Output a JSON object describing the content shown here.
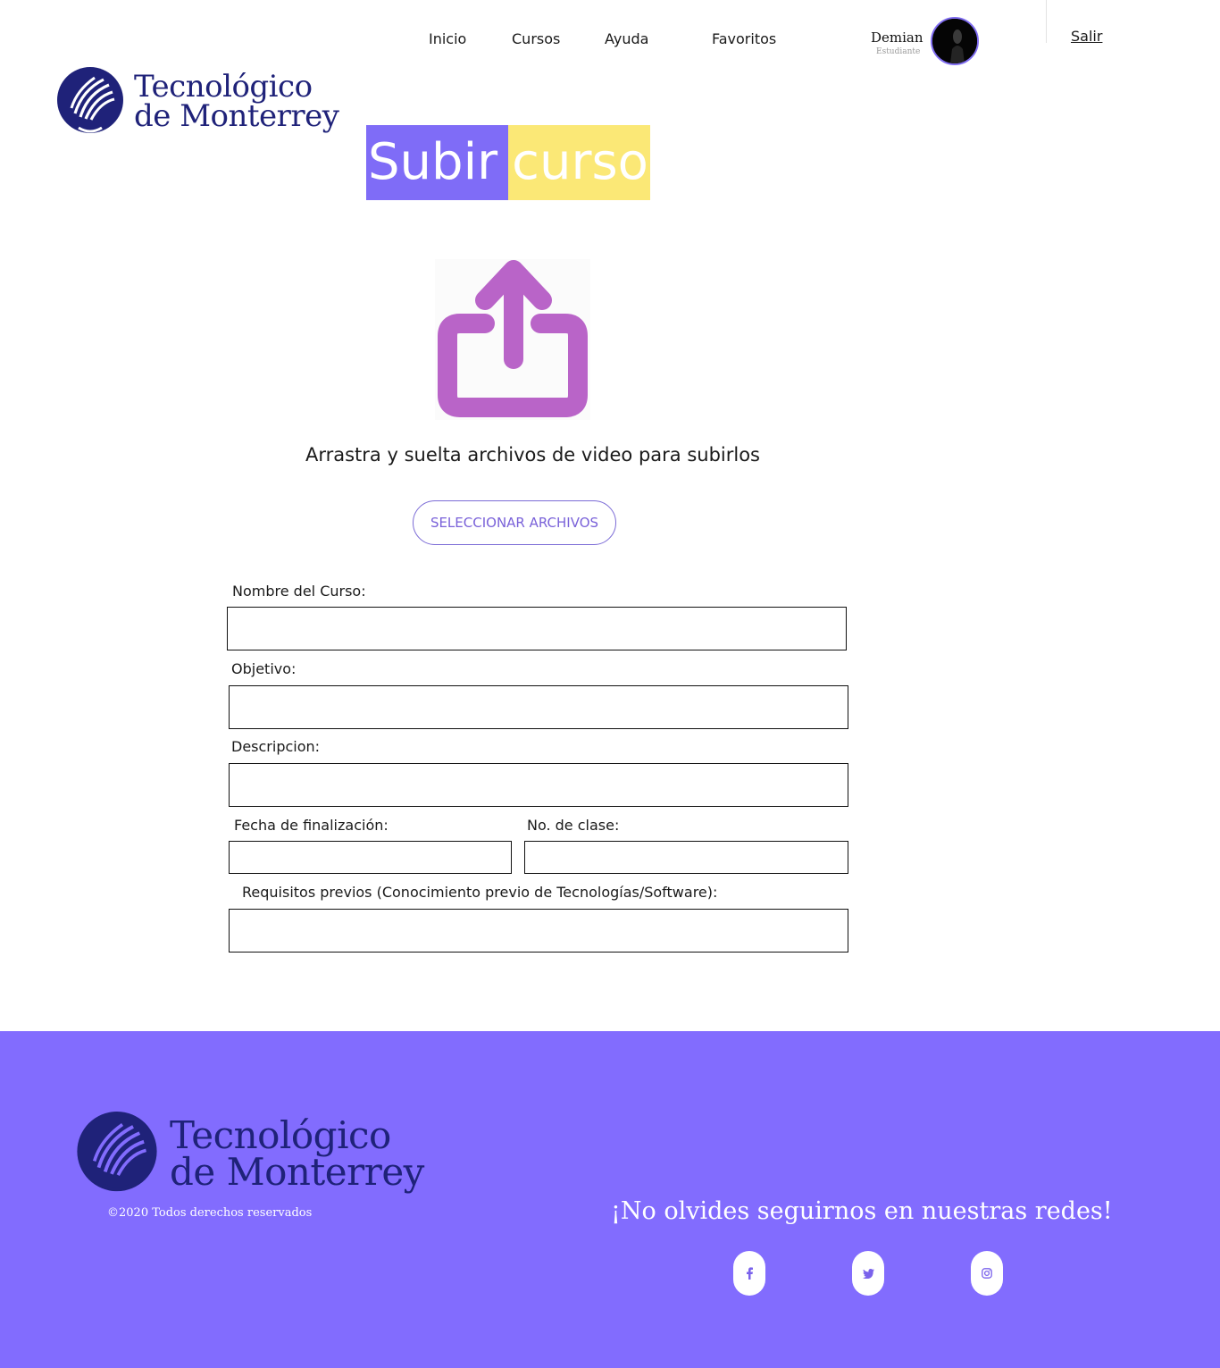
{
  "nav": {
    "links": [
      "Inicio",
      "Cursos",
      "Ayuda",
      "Favoritos"
    ],
    "user_name": "Demian",
    "user_role": "Estudiante",
    "logout_label": "Salir"
  },
  "brand": {
    "line1": "Tecnológico",
    "line2": "de Monterrey",
    "color": "#1f2279"
  },
  "page": {
    "title_part1": "Subir",
    "title_part2": "curso",
    "title_colors": [
      "#7f6cf7",
      "#fbe876"
    ],
    "upload_icon": "upload-share-icon",
    "upload_icon_color": "#b964c8",
    "drop_text": "Arrastra y suelta archivos de video para subirlos",
    "select_button": "SELECCIONAR ARCHIVOS"
  },
  "form": {
    "course_name_label": "Nombre del Curso:",
    "objective_label": "Objetivo:",
    "description_label": "Descripcion:",
    "end_date_label": "Fecha de finalización:",
    "class_number_label": "No. de clase:",
    "prerequisites_label": "Requisitos previos (Conocimiento previo de Tecnologías/Software):",
    "course_name_value": "",
    "objective_value": "",
    "description_value": "",
    "end_date_value": "",
    "class_number_value": "",
    "prerequisites_value": ""
  },
  "footer": {
    "copyright": "©2020 Todos derechos reservados",
    "follow_text": "¡No olvides seguirnos en nuestras redes!",
    "background": "#826cfe",
    "social": [
      {
        "icon": "facebook-icon",
        "glyph": "f"
      },
      {
        "icon": "twitter-icon",
        "glyph": "t"
      },
      {
        "icon": "instagram-icon",
        "glyph": "◎"
      }
    ]
  }
}
